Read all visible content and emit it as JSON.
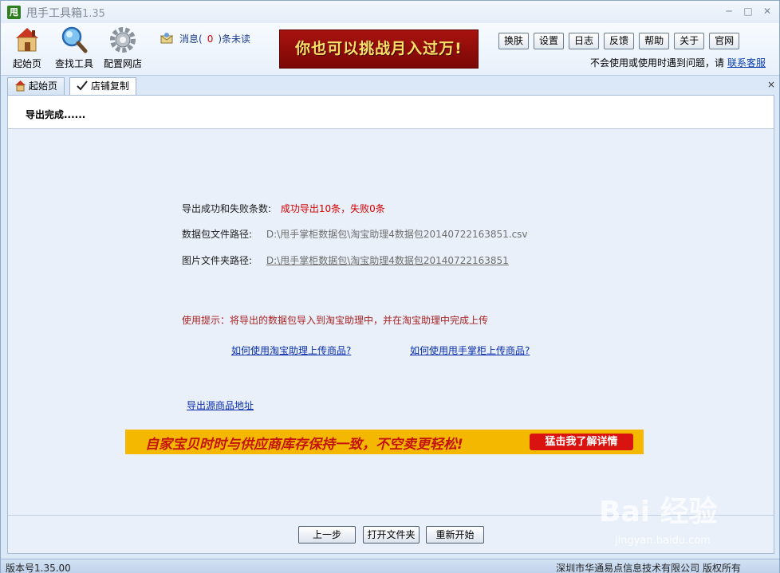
{
  "window": {
    "logo_char": "甩",
    "title": "甩手工具箱",
    "version": "1.35",
    "minimize": "─",
    "maximize": "□",
    "close": "✕"
  },
  "toolbar": {
    "tools": [
      {
        "label": "起始页",
        "icon": "home-icon"
      },
      {
        "label": "查找工具",
        "icon": "magnifier-icon"
      },
      {
        "label": "配置网店",
        "icon": "gear-icon"
      }
    ],
    "message": {
      "prefix": "消息(",
      "count": "0",
      "suffix": ")条未读"
    },
    "banner": "你也可以挑战月入过万!",
    "buttons": [
      "换肤",
      "设置",
      "日志",
      "反馈",
      "帮助",
      "关于",
      "官网"
    ],
    "help_text": "不会使用或使用时遇到问题，请",
    "help_link": "联系客服"
  },
  "tabs": [
    {
      "label": "起始页",
      "icon": "home-icon",
      "active": false
    },
    {
      "label": "店铺复制",
      "icon": "checkmark-pen-icon",
      "active": true
    }
  ],
  "tabs_close": "×",
  "panel": {
    "heading": "导出完成......",
    "result_label": "导出成功和失败条数:",
    "result_value": "成功导出10条，失败0条",
    "pkg_label": "数据包文件路径:",
    "pkg_path": "D:\\甩手掌柜数据包\\淘宝助理4数据包20140722163851.csv",
    "img_label": "图片文件夹路径:",
    "img_path": "D:\\甩手掌柜数据包\\淘宝助理4数据包20140722163851",
    "hint": "使用提示：将导出的数据包导入到淘宝助理中，并在淘宝助理中完成上传",
    "link1": "如何使用淘宝助理上传商品?",
    "link2": "如何使用甩手掌柜上传商品?",
    "export_link": "导出源商品地址",
    "promo_text": "自家宝贝时时与供应商库存保持一致，不空卖更轻松!",
    "promo_button": "猛击我了解详情",
    "btn_prev": "上一步",
    "btn_open": "打开文件夹",
    "btn_restart": "重新开始"
  },
  "statusbar": {
    "version": "版本号1.35.00",
    "copyright": "深圳市华通易点信息技术有限公司 版权所有"
  },
  "watermark": {
    "main": "Bai 经验",
    "sub": "jingyan.baidu.com"
  }
}
